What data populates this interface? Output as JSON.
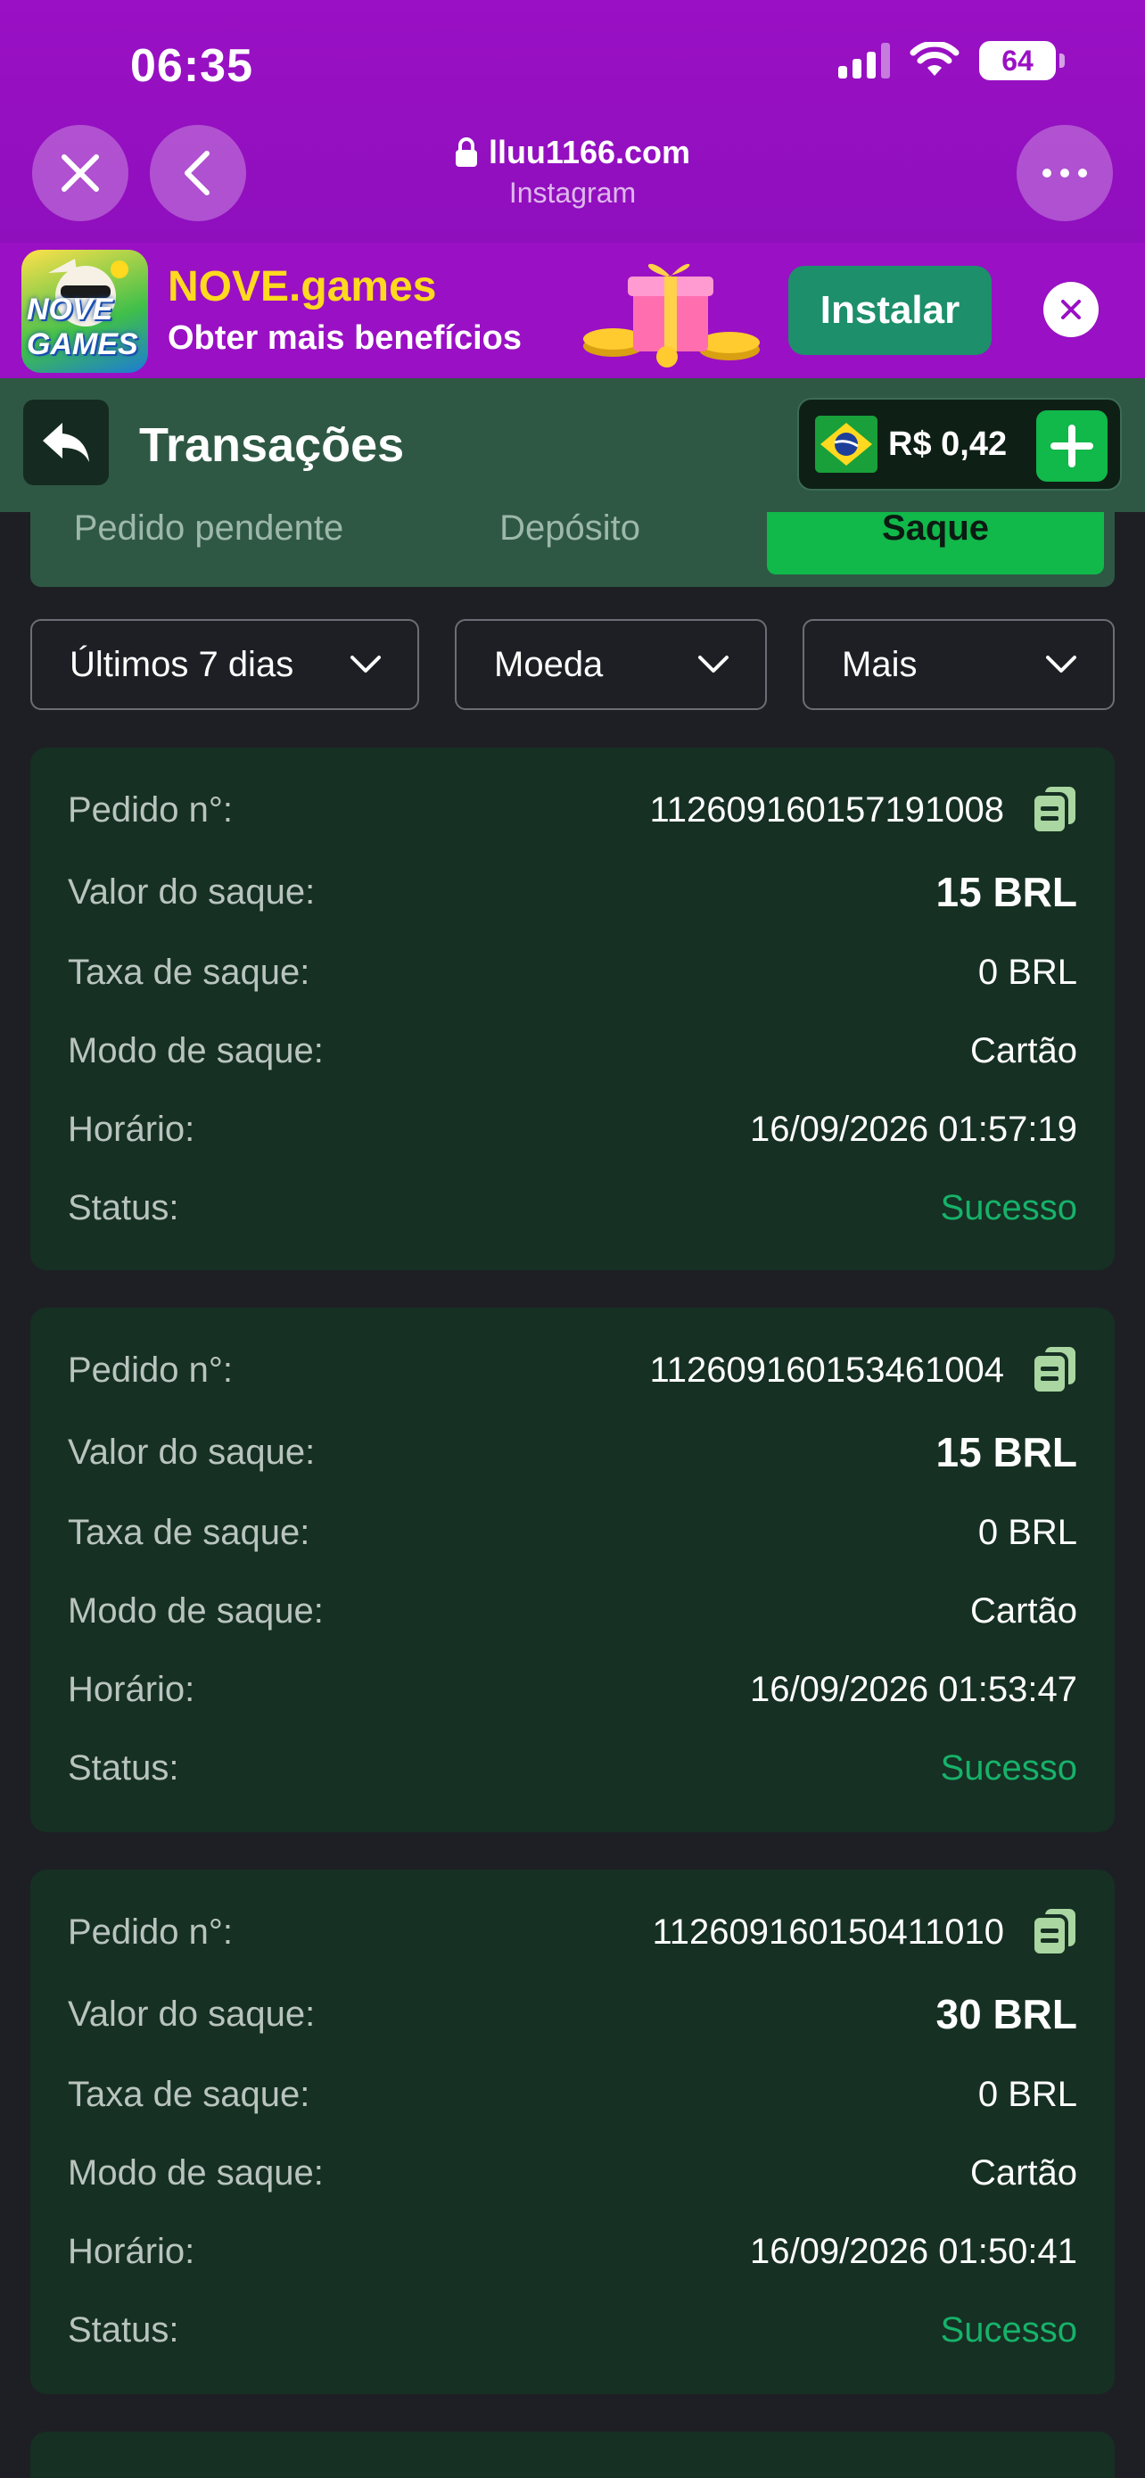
{
  "status_bar": {
    "time": "06:35",
    "battery": "64"
  },
  "browser": {
    "url": "lluu1166.com",
    "source": "Instagram"
  },
  "banner": {
    "app_logo_text": "NOVE GAMES",
    "title": "NOVE.games",
    "subtitle": "Obter mais benefícios",
    "install_label": "Instalar"
  },
  "header": {
    "title": "Transações",
    "balance": "R$ 0,42"
  },
  "tabs": [
    {
      "label": "Pedido pendente"
    },
    {
      "label": "Depósito"
    },
    {
      "label": "Saque"
    }
  ],
  "filters": {
    "period": "Últimos 7 dias",
    "currency": "Moeda",
    "more": "Mais"
  },
  "labels": {
    "order": "Pedido n°:",
    "amount": "Valor do saque:",
    "fee": "Taxa de saque:",
    "mode": "Modo de saque:",
    "time": "Horário:",
    "status": "Status:"
  },
  "transactions": [
    {
      "order": "112609160157191008",
      "amount": "15 BRL",
      "fee": "0 BRL",
      "mode": "Cartão",
      "time": "16/09/2026 01:57:19",
      "status": "Sucesso"
    },
    {
      "order": "112609160153461004",
      "amount": "15 BRL",
      "fee": "0 BRL",
      "mode": "Cartão",
      "time": "16/09/2026 01:53:47",
      "status": "Sucesso"
    },
    {
      "order": "112609160150411010",
      "amount": "30 BRL",
      "fee": "0 BRL",
      "mode": "Cartão",
      "time": "16/09/2026 01:50:41",
      "status": "Sucesso"
    }
  ],
  "colors": {
    "browser_purple": "#9a10c4",
    "header_green": "#2e5844",
    "card_bg": "#163023",
    "accent_green": "#11b84a",
    "success_text": "#17b26a"
  }
}
